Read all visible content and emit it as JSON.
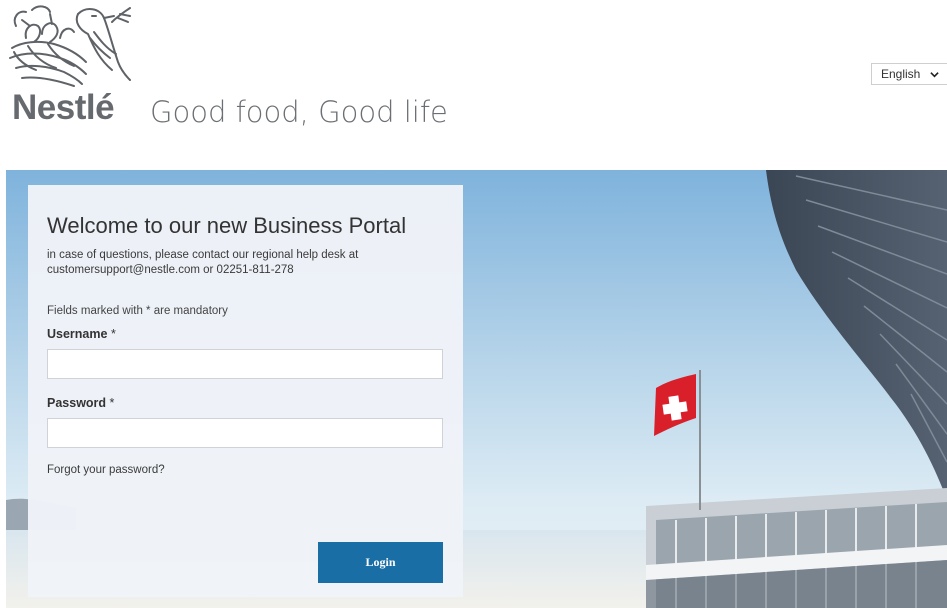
{
  "brand": {
    "wordmark": "Nestlé",
    "tagline": "Good food, Good life",
    "logo_icon": "nest-bird-icon",
    "wordmark_color": "#666a6e"
  },
  "language": {
    "selected": "English",
    "icon": "chevron-down-icon"
  },
  "login": {
    "title": "Welcome to our new Business Portal",
    "help_line1": "in case of questions, please contact our regional help desk at",
    "help_line2": "customersupport@nestle.com or 02251-811-278",
    "mandatory_note": "Fields marked with * are mandatory",
    "username_label": "Username",
    "username_value": "",
    "password_label": "Password",
    "password_value": "",
    "required_marker": "*",
    "forgot_link": "Forgot your password?",
    "login_button": "Login",
    "button_color": "#1a6ea6"
  },
  "hero": {
    "image": "nestle-headquarters-swiss-flag-lake"
  }
}
